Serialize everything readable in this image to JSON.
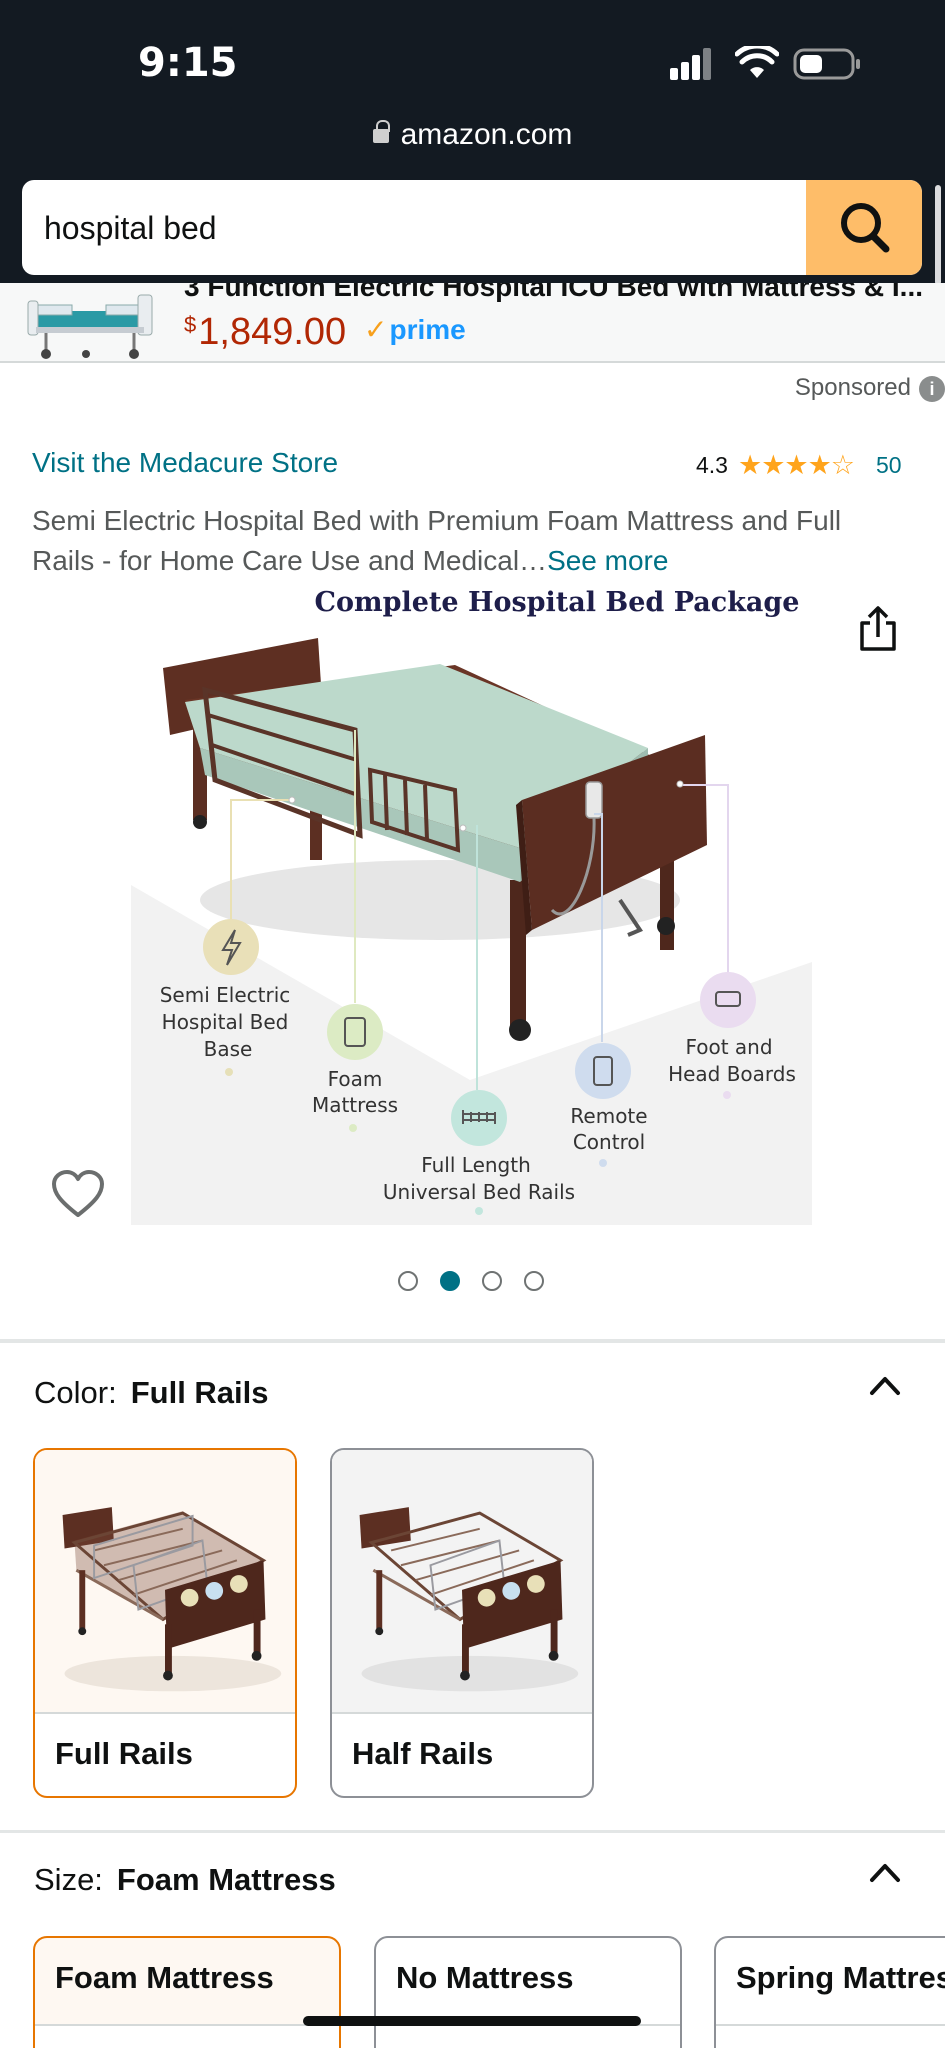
{
  "status_bar": {
    "time": "9:15",
    "url": "amazon.com"
  },
  "search": {
    "value": "hospital bed",
    "button": "search-icon"
  },
  "sponsored_banner": {
    "title": "3 Function Electric Hospital ICU Bed with Mattress & I...",
    "price_symbol": "$",
    "price": "1,849.00",
    "prime_check": "✓",
    "prime": "prime"
  },
  "sponsored_label": "Sponsored",
  "info_symbol": "i",
  "product": {
    "store_link": "Visit the Medacure Store",
    "rating": "4.3",
    "rating_value": 4.3,
    "stars": "★★★★☆",
    "review_count": "50",
    "title": "Semi Electric Hospital Bed with Premium Foam Mattress and Full Rails - for Home Care Use and Medical…",
    "see_more": "See more"
  },
  "hero_image": {
    "heading": "Complete Hospital Bed Package",
    "callouts": [
      {
        "line1": "Semi Electric",
        "line2": "Hospital Bed",
        "line3": "Base"
      },
      {
        "line1": "Foam",
        "line2": "Mattress"
      },
      {
        "line1": "Full Length",
        "line2": "Universal Bed Rails"
      },
      {
        "line1": "Remote",
        "line2": "Control"
      },
      {
        "line1": "Foot and",
        "line2": "Head Boards"
      }
    ],
    "page_count": 4,
    "active_page": 2
  },
  "color": {
    "label": "Color:",
    "selected": "Full Rails",
    "options": [
      {
        "name": "Full Rails"
      },
      {
        "name": "Half Rails"
      }
    ]
  },
  "size": {
    "label": "Size:",
    "selected": "Foam Mattress",
    "options": [
      {
        "name": "Foam Mattress"
      },
      {
        "name": "No Mattress"
      },
      {
        "name": "Spring Mattress"
      }
    ]
  },
  "colors": {
    "link": "#007185",
    "price": "#b12704",
    "search_button": "#febd69",
    "selected_border": "#e77600",
    "header_bg": "#131a22"
  }
}
